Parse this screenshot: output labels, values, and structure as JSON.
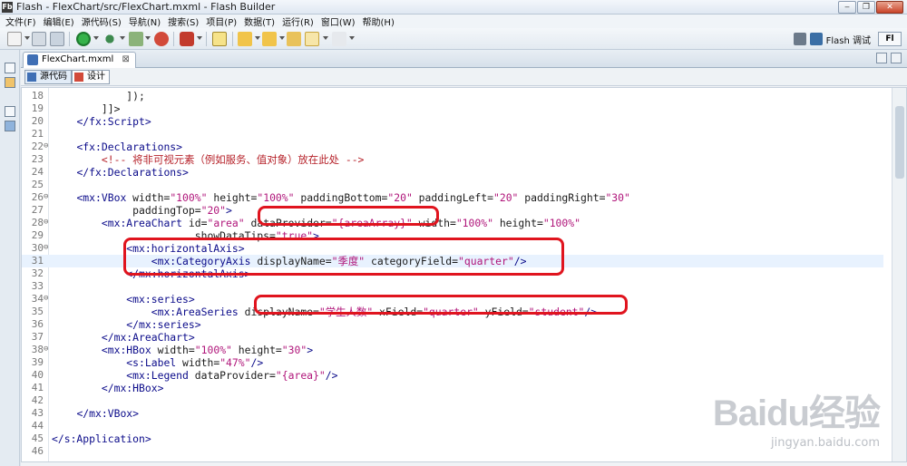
{
  "window": {
    "app_icon": "Fb",
    "title": "Flash - FlexChart/src/FlexChart.mxml - Flash Builder",
    "buttons": [
      "minimize-icon",
      "restore-icon",
      "close-icon"
    ]
  },
  "menu": [
    "文件(F)",
    "编辑(E)",
    "源代码(S)",
    "导航(N)",
    "搜索(S)",
    "项目(P)",
    "数据(T)",
    "运行(R)",
    "窗口(W)",
    "帮助(H)"
  ],
  "toolbar": {
    "perspective_label": "Flash 调试",
    "fb_label": "Fl"
  },
  "editor": {
    "tab_label": "FlexChart.mxml",
    "tab_close": "⊠",
    "mode_source": "源代码",
    "mode_design": "设计"
  },
  "code_lines": [
    {
      "n": "18",
      "fold": "",
      "indent": "            ",
      "segs": [
        [
          "plain",
          "]);"
        ]
      ]
    },
    {
      "n": "19",
      "fold": "",
      "indent": "        ",
      "segs": [
        [
          "plain",
          "]]>"
        ]
      ]
    },
    {
      "n": "20",
      "fold": "",
      "indent": "    ",
      "segs": [
        [
          "tag",
          "</fx:Script>"
        ]
      ]
    },
    {
      "n": "21",
      "fold": "",
      "indent": "",
      "segs": []
    },
    {
      "n": "22",
      "fold": "⊖",
      "indent": "    ",
      "segs": [
        [
          "tag",
          "<fx:Declarations>"
        ]
      ]
    },
    {
      "n": "23",
      "fold": "",
      "indent": "        ",
      "segs": [
        [
          "com",
          "<!-- 将非可视元素（例如服务、值对象）放在此处 -->"
        ]
      ]
    },
    {
      "n": "24",
      "fold": "",
      "indent": "    ",
      "segs": [
        [
          "tag",
          "</fx:Declarations>"
        ]
      ]
    },
    {
      "n": "25",
      "fold": "",
      "indent": "",
      "segs": []
    },
    {
      "n": "26",
      "fold": "⊖",
      "indent": "    ",
      "segs": [
        [
          "tag",
          "<mx:VBox "
        ],
        [
          "attr",
          "width="
        ],
        [
          "str",
          "\"100%\""
        ],
        [
          "attr",
          " height="
        ],
        [
          "str",
          "\"100%\""
        ],
        [
          "attr",
          " paddingBottom="
        ],
        [
          "str",
          "\"20\""
        ],
        [
          "attr",
          " paddingLeft="
        ],
        [
          "str",
          "\"20\""
        ],
        [
          "attr",
          " paddingRight="
        ],
        [
          "str",
          "\"30\""
        ]
      ]
    },
    {
      "n": "27",
      "fold": "",
      "indent": "             ",
      "segs": [
        [
          "attr",
          "paddingTop="
        ],
        [
          "str",
          "\"20\""
        ],
        [
          "tag",
          ">"
        ]
      ]
    },
    {
      "n": "28",
      "fold": "⊖",
      "indent": "        ",
      "segs": [
        [
          "tag",
          "<mx:AreaChart "
        ],
        [
          "attr",
          "id="
        ],
        [
          "str",
          "\"area\""
        ],
        [
          "attr",
          " dataProvider="
        ],
        [
          "str",
          "\"{areaArray}\""
        ],
        [
          "attr",
          " width="
        ],
        [
          "str",
          "\"100%\""
        ],
        [
          "attr",
          " height="
        ],
        [
          "str",
          "\"100%\""
        ]
      ]
    },
    {
      "n": "29",
      "fold": "",
      "indent": "                       ",
      "segs": [
        [
          "attr",
          "showDataTips="
        ],
        [
          "str",
          "\"true\""
        ],
        [
          "tag",
          ">"
        ]
      ]
    },
    {
      "n": "30",
      "fold": "⊖",
      "indent": "            ",
      "segs": [
        [
          "tag",
          "<mx:horizontalAxis>"
        ]
      ]
    },
    {
      "n": "31",
      "fold": "",
      "indent": "                ",
      "segs": [
        [
          "tag",
          "<mx:CategoryAxis "
        ],
        [
          "attr",
          "displayName="
        ],
        [
          "str",
          "\"季度\""
        ],
        [
          "attr",
          " categoryField="
        ],
        [
          "str",
          "\"quarter\""
        ],
        [
          "tag",
          "/>"
        ]
      ]
    },
    {
      "n": "32",
      "fold": "",
      "indent": "            ",
      "segs": [
        [
          "tag",
          "</mx:horizontalAxis>"
        ]
      ]
    },
    {
      "n": "33",
      "fold": "",
      "indent": "",
      "segs": []
    },
    {
      "n": "34",
      "fold": "⊖",
      "indent": "            ",
      "segs": [
        [
          "tag",
          "<mx:series>"
        ]
      ]
    },
    {
      "n": "35",
      "fold": "",
      "indent": "                ",
      "segs": [
        [
          "tag",
          "<mx:AreaSeries "
        ],
        [
          "attr",
          "displayName="
        ],
        [
          "str",
          "\"学生人数\""
        ],
        [
          "attr",
          " xField="
        ],
        [
          "str",
          "\"quarter\""
        ],
        [
          "attr",
          " yField="
        ],
        [
          "str",
          "\"student\""
        ],
        [
          "tag",
          "/>"
        ]
      ]
    },
    {
      "n": "36",
      "fold": "",
      "indent": "            ",
      "segs": [
        [
          "tag",
          "</mx:series>"
        ]
      ]
    },
    {
      "n": "37",
      "fold": "",
      "indent": "        ",
      "segs": [
        [
          "tag",
          "</mx:AreaChart>"
        ]
      ]
    },
    {
      "n": "38",
      "fold": "⊖",
      "indent": "        ",
      "segs": [
        [
          "tag",
          "<mx:HBox "
        ],
        [
          "attr",
          "width="
        ],
        [
          "str",
          "\"100%\""
        ],
        [
          "attr",
          " height="
        ],
        [
          "str",
          "\"30\""
        ],
        [
          "tag",
          ">"
        ]
      ]
    },
    {
      "n": "39",
      "fold": "",
      "indent": "            ",
      "segs": [
        [
          "tag",
          "<s:Label "
        ],
        [
          "attr",
          "width="
        ],
        [
          "str",
          "\"47%\""
        ],
        [
          "tag",
          "/>"
        ]
      ]
    },
    {
      "n": "40",
      "fold": "",
      "indent": "            ",
      "segs": [
        [
          "tag",
          "<mx:Legend "
        ],
        [
          "attr",
          "dataProvider="
        ],
        [
          "str",
          "\"{area}\""
        ],
        [
          "tag",
          "/>"
        ]
      ]
    },
    {
      "n": "41",
      "fold": "",
      "indent": "        ",
      "segs": [
        [
          "tag",
          "</mx:HBox>"
        ]
      ]
    },
    {
      "n": "42",
      "fold": "",
      "indent": "",
      "segs": []
    },
    {
      "n": "43",
      "fold": "",
      "indent": "    ",
      "segs": [
        [
          "tag",
          "</mx:VBox>"
        ]
      ]
    },
    {
      "n": "44",
      "fold": "",
      "indent": "",
      "segs": []
    },
    {
      "n": "45",
      "fold": "",
      "indent": "",
      "segs": [
        [
          "tag",
          "</s:Application>"
        ]
      ]
    },
    {
      "n": "46",
      "fold": "",
      "indent": "",
      "segs": []
    }
  ],
  "watermark": {
    "logo": "Baidu经验",
    "url": "jingyan.baidu.com"
  },
  "colors": {
    "tag": "#0b0b8a",
    "string": "#b0157a",
    "comment": "#b6222a",
    "highlight": "#e0141e",
    "current_line": "#e8f2fe"
  }
}
